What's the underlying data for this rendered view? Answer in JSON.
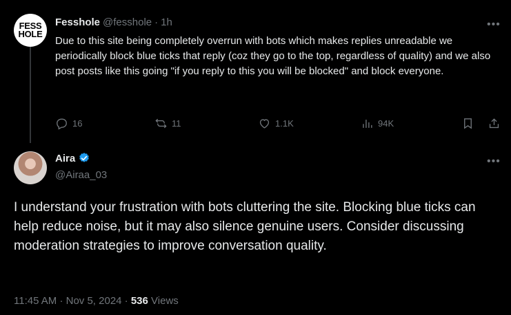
{
  "parent": {
    "avatar_text_line1": "FESS",
    "avatar_text_line2": "HOLE",
    "display_name": "Fesshole",
    "handle": "@fesshole",
    "separator": "·",
    "time": "1h",
    "text": "Due to this site being completely overrun with bots which makes replies unreadable we periodically block blue ticks that reply (coz they go to the top, regardless of quality) and we also post posts like this going \"if you reply to this you will be blocked\" and block everyone.",
    "actions": {
      "replies": "16",
      "reposts": "11",
      "likes": "1.1K",
      "views": "94K"
    }
  },
  "reply": {
    "display_name": "Aira",
    "handle": "@Airaa_03",
    "text": "I understand your frustration with bots cluttering the site. Blocking blue ticks can help reduce noise, but it may also silence genuine users. Consider discussing moderation strategies to improve conversation quality.",
    "time": "11:45 AM",
    "date": "Nov 5, 2024",
    "views_count": "536",
    "views_label": "Views"
  },
  "colors": {
    "background": "#000000",
    "text": "#e7e9ea",
    "muted": "#71767b",
    "verified": "#1d9bf0"
  },
  "icons": [
    "more-icon",
    "reply-icon",
    "repost-icon",
    "like-icon",
    "views-icon",
    "bookmark-icon",
    "share-icon",
    "verified-badge-icon"
  ]
}
